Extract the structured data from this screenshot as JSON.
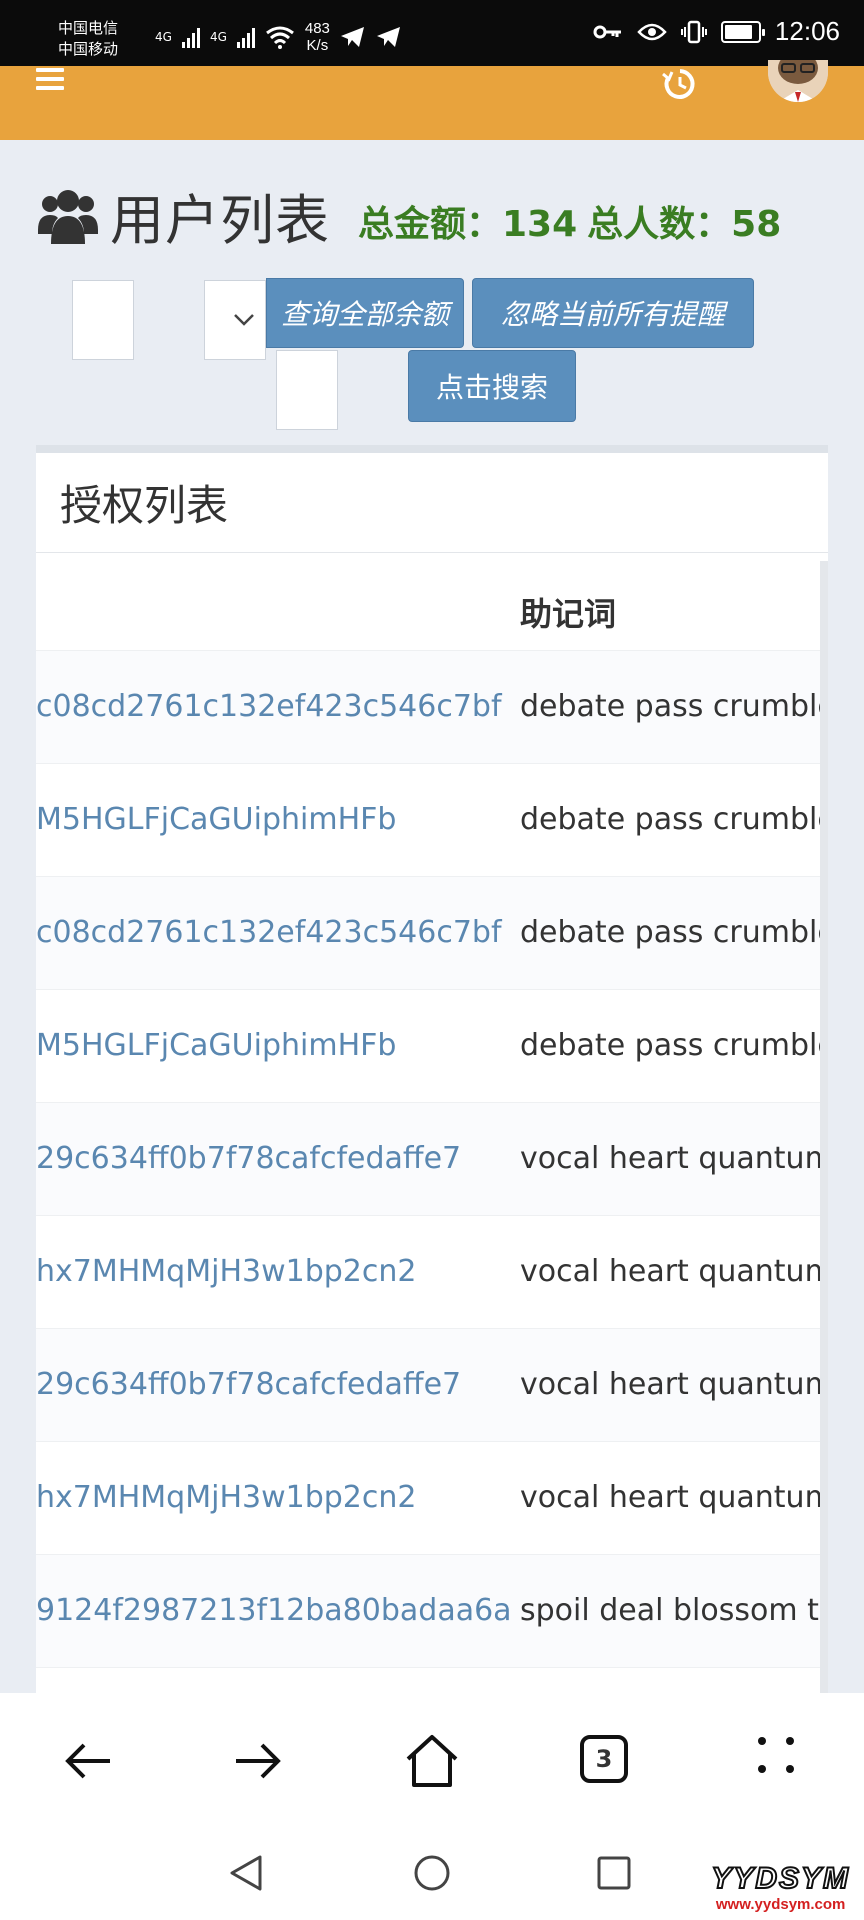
{
  "status_bar": {
    "carrier1": "中国电信",
    "carrier2": "中国移动",
    "net1": "4G",
    "net2": "4G",
    "speed_value": "483",
    "speed_unit": "K/s",
    "time": "12:06",
    "battery_level": 0.85
  },
  "header": {
    "title": "用户列表",
    "total_amount": "总金额：134",
    "total_users": "总人数：58"
  },
  "controls": {
    "query_all_balance": "查询全部余额",
    "ignore_reminders": "忽略当前所有提醒",
    "search": "点击搜索"
  },
  "panel": {
    "title": "授权列表",
    "column_mnemonic": "助记词",
    "rows": [
      {
        "addr": "c08cd2761c132ef423c546c7bf",
        "mnemonic": "debate pass crumble w"
      },
      {
        "addr": "M5HGLFjCaGUiphimHFb",
        "mnemonic": "debate pass crumble w"
      },
      {
        "addr": "c08cd2761c132ef423c546c7bf",
        "mnemonic": "debate pass crumble w"
      },
      {
        "addr": "M5HGLFjCaGUiphimHFb",
        "mnemonic": "debate pass crumble w"
      },
      {
        "addr": "29c634ff0b7f78cafcfedaffe7",
        "mnemonic": "vocal heart quantum s"
      },
      {
        "addr": "hx7MHMqMjH3w1bp2cn2",
        "mnemonic": "vocal heart quantum s"
      },
      {
        "addr": "29c634ff0b7f78cafcfedaffe7",
        "mnemonic": "vocal heart quantum s"
      },
      {
        "addr": "hx7MHMqMjH3w1bp2cn2",
        "mnemonic": "vocal heart quantum s"
      },
      {
        "addr": "9124f2987213f12ba80badaa6a",
        "mnemonic": "spoil deal blossom tra"
      }
    ]
  },
  "browser": {
    "tab_count": "3"
  },
  "watermark": {
    "logo": "YYDSYM",
    "url": "www.yydsym.com"
  }
}
